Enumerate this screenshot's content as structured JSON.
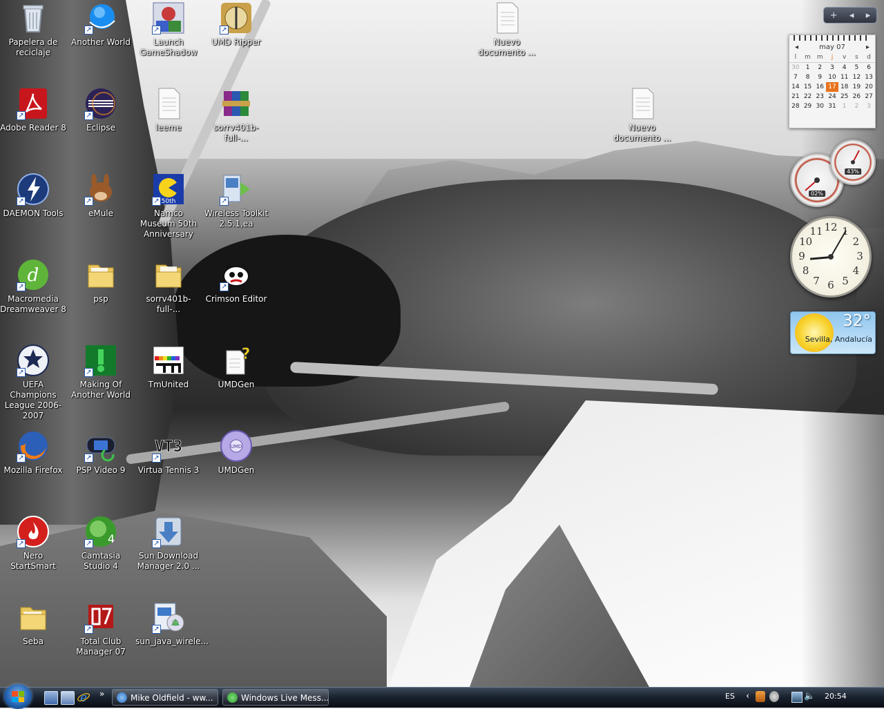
{
  "desktop": {
    "icons": [
      {
        "label": "Papelera de reciclaje"
      },
      {
        "label": "Another World"
      },
      {
        "label": "Launch GameShadow"
      },
      {
        "label": "UMD Ripper"
      },
      {
        "label": "Nuevo documento ..."
      },
      {
        "label": "Adobe Reader 8"
      },
      {
        "label": "Eclipse"
      },
      {
        "label": "leeme"
      },
      {
        "label": "sorrv401b-full-..."
      },
      {
        "label": "Nuevo documento ..."
      },
      {
        "label": "DAEMON Tools"
      },
      {
        "label": "eMule"
      },
      {
        "label": "Namco Museum 50th Anniversary"
      },
      {
        "label": "Wireless Toolkit 2.5.1,ea"
      },
      {
        "label": "Macromedia Dreamweaver 8"
      },
      {
        "label": "psp"
      },
      {
        "label": "sorrv401b-full-..."
      },
      {
        "label": "Crimson Editor"
      },
      {
        "label": "UEFA Champions League 2006-2007"
      },
      {
        "label": "Making Of Another World"
      },
      {
        "label": "TmUnited"
      },
      {
        "label": "UMDGen"
      },
      {
        "label": "Mozilla Firefox"
      },
      {
        "label": "PSP Video 9"
      },
      {
        "label": "Virtua Tennis 3"
      },
      {
        "label": "UMDGen"
      },
      {
        "label": "Nero StartSmart"
      },
      {
        "label": "Camtasia Studio 4"
      },
      {
        "label": "Sun Download Manager 2.0 ..."
      },
      {
        "label": "Seba"
      },
      {
        "label": "Total Club Manager 07"
      },
      {
        "label": "sun_java_wirele..."
      }
    ]
  },
  "sidebar": {
    "controls": {
      "add": "+",
      "prev": "◂",
      "next": "▸"
    },
    "calendar": {
      "month": "may 07",
      "weekdays": [
        "l",
        "m",
        "m",
        "j",
        "v",
        "s",
        "d"
      ],
      "weeks": [
        [
          "30",
          "1",
          "2",
          "3",
          "4",
          "5",
          "6"
        ],
        [
          "7",
          "8",
          "9",
          "10",
          "11",
          "12",
          "13"
        ],
        [
          "14",
          "15",
          "16",
          "17",
          "18",
          "19",
          "20"
        ],
        [
          "21",
          "22",
          "23",
          "24",
          "25",
          "26",
          "27"
        ],
        [
          "28",
          "29",
          "30",
          "31",
          "1",
          "2",
          "3"
        ]
      ],
      "today": "17"
    },
    "cpu_meter": {
      "cpu": "02%",
      "memory": "43%"
    },
    "clock": {
      "numbers": [
        "12",
        "1",
        "2",
        "3",
        "4",
        "5",
        "6",
        "7",
        "8",
        "9",
        "10",
        "11"
      ]
    },
    "weather": {
      "temperature": "32°",
      "location": "Sevilla, Andalucía"
    }
  },
  "taskbar": {
    "overflow": "»",
    "tasks": [
      {
        "label": "Mike Oldfield - ww...",
        "icon": "ie-icon"
      },
      {
        "label": "Windows Live Mess...",
        "icon": "messenger-icon"
      }
    ],
    "tray": {
      "language": "ES",
      "time": "20:54",
      "arrow": "‹"
    }
  }
}
